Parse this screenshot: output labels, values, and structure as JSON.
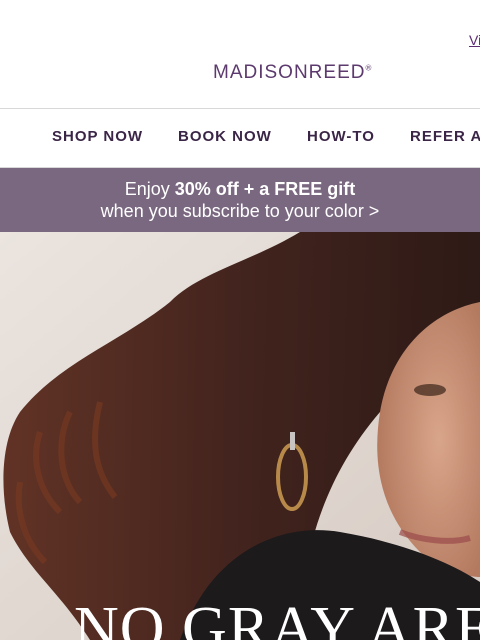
{
  "header": {
    "view_link": "View",
    "logo": {
      "text": "MADISONREED",
      "mark": "®"
    }
  },
  "nav": {
    "items": [
      {
        "label": "SHOP NOW"
      },
      {
        "label": "BOOK NOW"
      },
      {
        "label": "HOW-TO"
      },
      {
        "label": "REFER A"
      }
    ]
  },
  "promo": {
    "line1_prefix": "Enjoy ",
    "line1_bold": "30% off + a FREE gift",
    "line2": "when you subscribe to your color >"
  },
  "hero": {
    "headline": "NO GRAY ARE"
  },
  "colors": {
    "brand_purple": "#5c3a6e",
    "nav_text": "#3b2547",
    "promo_bg": "#7a6880"
  }
}
